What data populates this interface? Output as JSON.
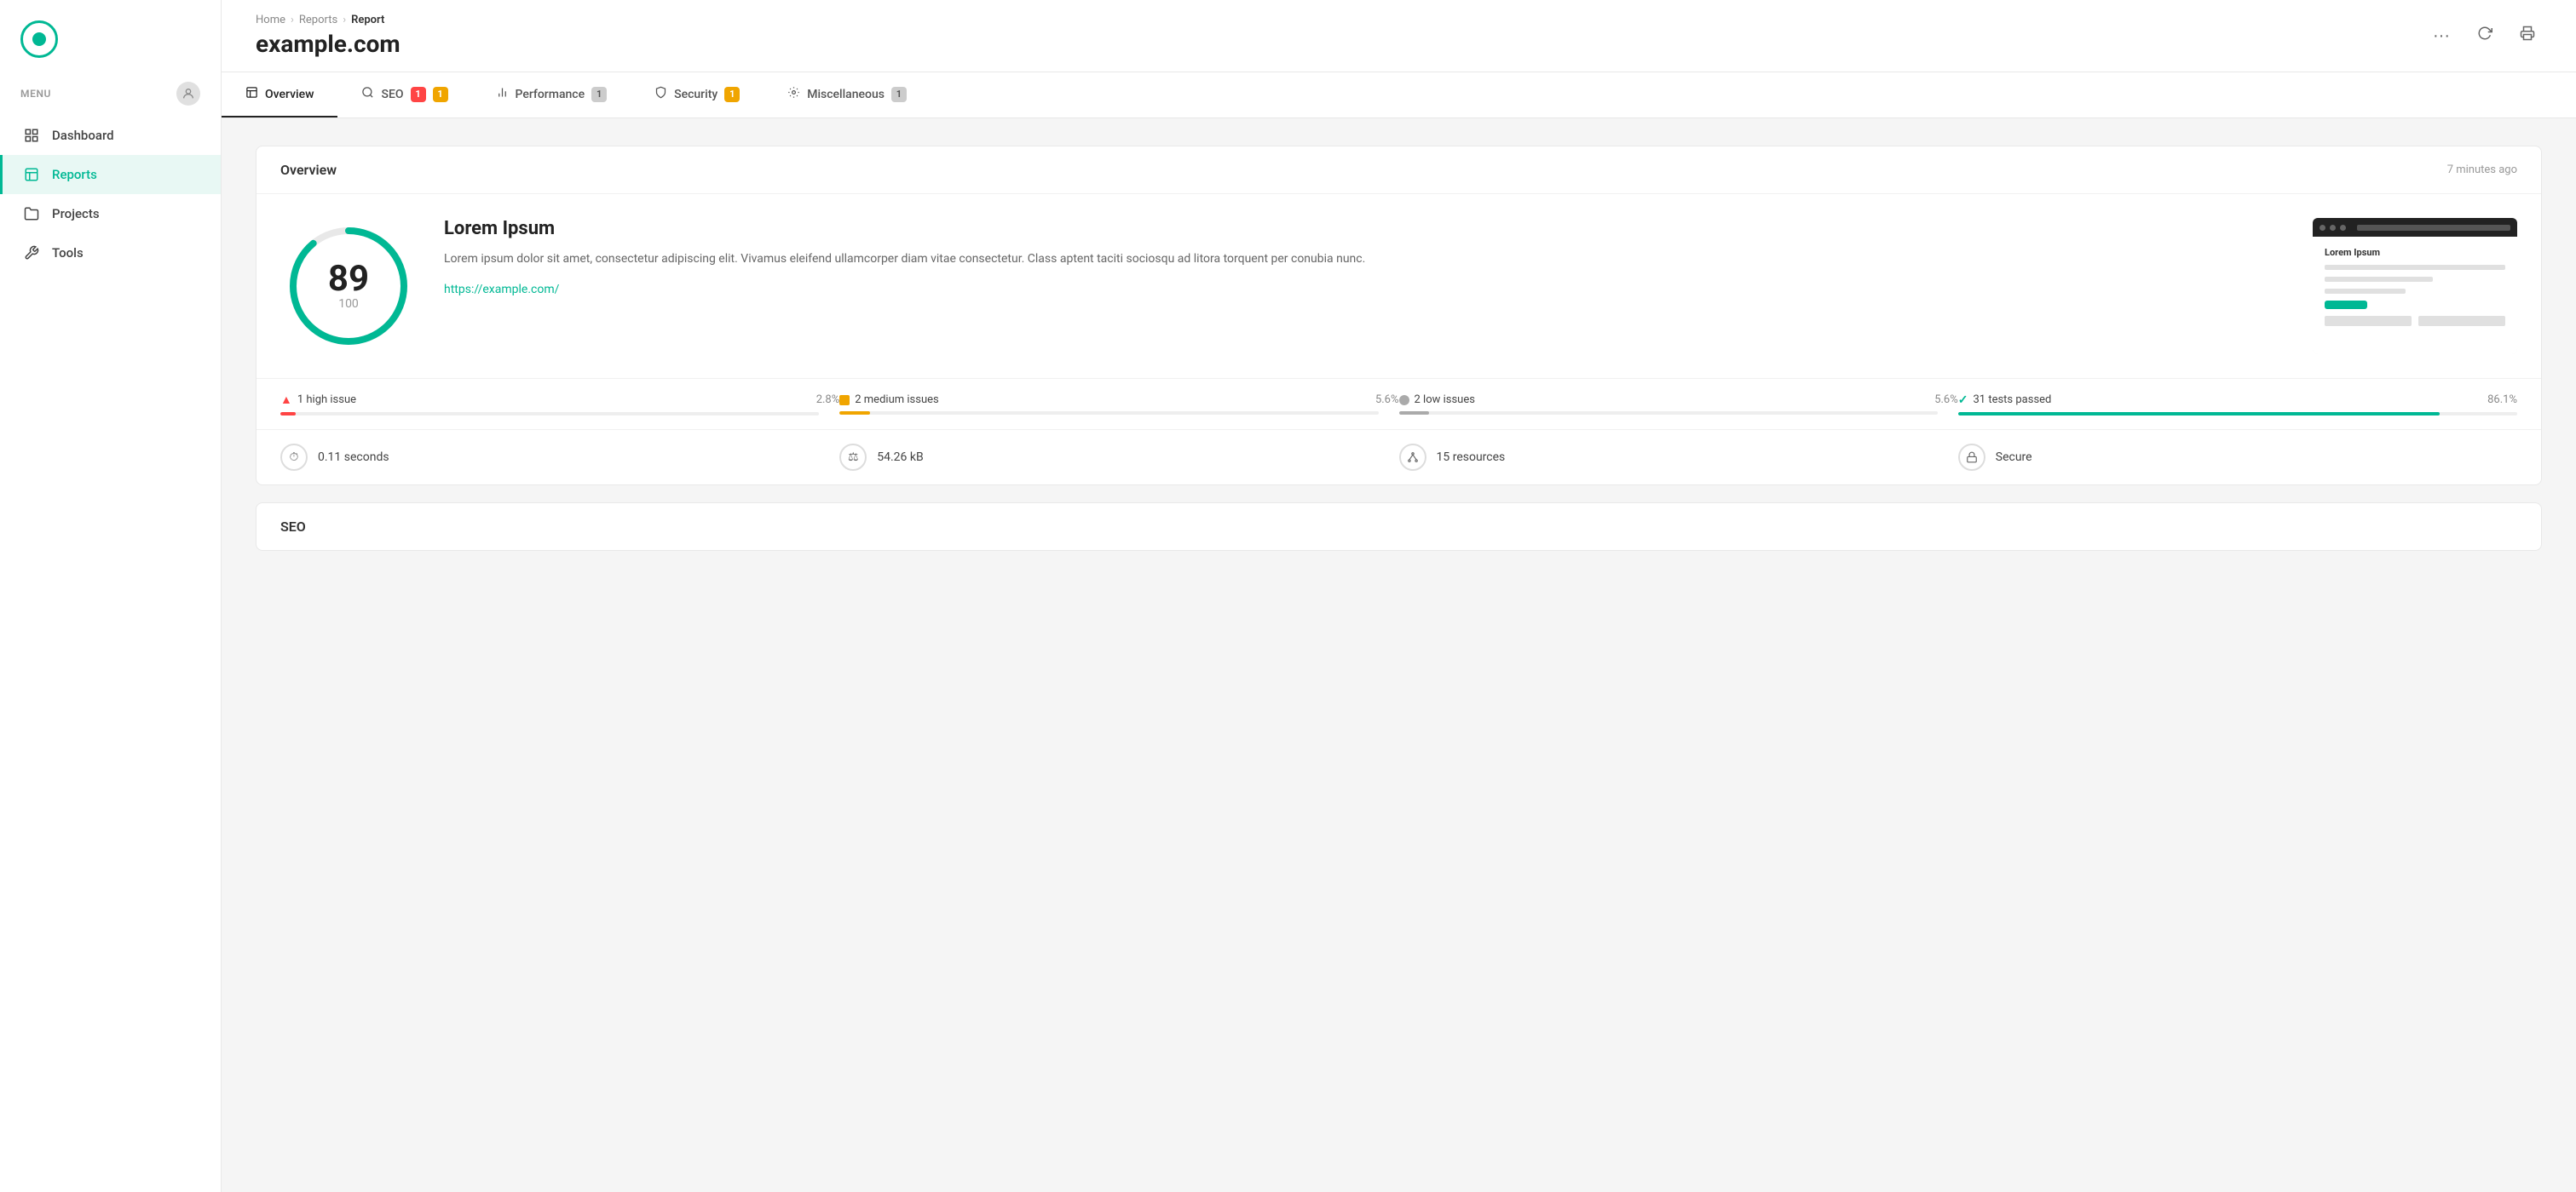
{
  "sidebar": {
    "menu_label": "MENU",
    "nav_items": [
      {
        "id": "dashboard",
        "label": "Dashboard",
        "active": false
      },
      {
        "id": "reports",
        "label": "Reports",
        "active": true
      },
      {
        "id": "projects",
        "label": "Projects",
        "active": false
      },
      {
        "id": "tools",
        "label": "Tools",
        "active": false
      }
    ]
  },
  "breadcrumb": {
    "home": "Home",
    "reports": "Reports",
    "current": "Report"
  },
  "header": {
    "site_title": "example.com",
    "more_label": "···",
    "refresh_label": "↻",
    "print_label": "🖨"
  },
  "tabs": [
    {
      "id": "overview",
      "label": "Overview",
      "badge": null,
      "badge_type": null,
      "active": true
    },
    {
      "id": "seo",
      "label": "SEO",
      "badge": "1",
      "badge2": "1",
      "badge_type": "multi",
      "active": false
    },
    {
      "id": "performance",
      "label": "Performance",
      "badge": "1",
      "badge_type": "gray",
      "active": false
    },
    {
      "id": "security",
      "label": "Security",
      "badge": "1",
      "badge_type": "yellow",
      "active": false
    },
    {
      "id": "miscellaneous",
      "label": "Miscellaneous",
      "badge": "1",
      "badge_type": "gray",
      "active": false
    }
  ],
  "overview": {
    "title": "Overview",
    "timestamp": "7 minutes ago",
    "score": "89",
    "score_total": "100",
    "score_percent": 89,
    "site_name": "Lorem Ipsum",
    "description": "Lorem ipsum dolor sit amet, consectetur adipiscing elit. Vivamus eleifend ullamcorper diam vitae consectetur. Class aptent taciti sociosqu ad litora torquent per conubia nunc.",
    "url": "https://example.com/",
    "issues": [
      {
        "label": "1 high issue",
        "pct": "2.8%",
        "pct_val": 2.8,
        "type": "red"
      },
      {
        "label": "2 medium issues",
        "pct": "5.6%",
        "pct_val": 5.6,
        "type": "yellow"
      },
      {
        "label": "2 low issues",
        "pct": "5.6%",
        "pct_val": 5.6,
        "type": "gray"
      },
      {
        "label": "31 tests passed",
        "pct": "86.1%",
        "pct_val": 86.1,
        "type": "green"
      }
    ],
    "stats": [
      {
        "label": "0.11 seconds",
        "icon": "⏱"
      },
      {
        "label": "54.26 kB",
        "icon": "⚖"
      },
      {
        "label": "15 resources",
        "icon": "⚙"
      },
      {
        "label": "Secure",
        "icon": "🔒"
      }
    ]
  },
  "seo_section": {
    "title": "SEO"
  }
}
